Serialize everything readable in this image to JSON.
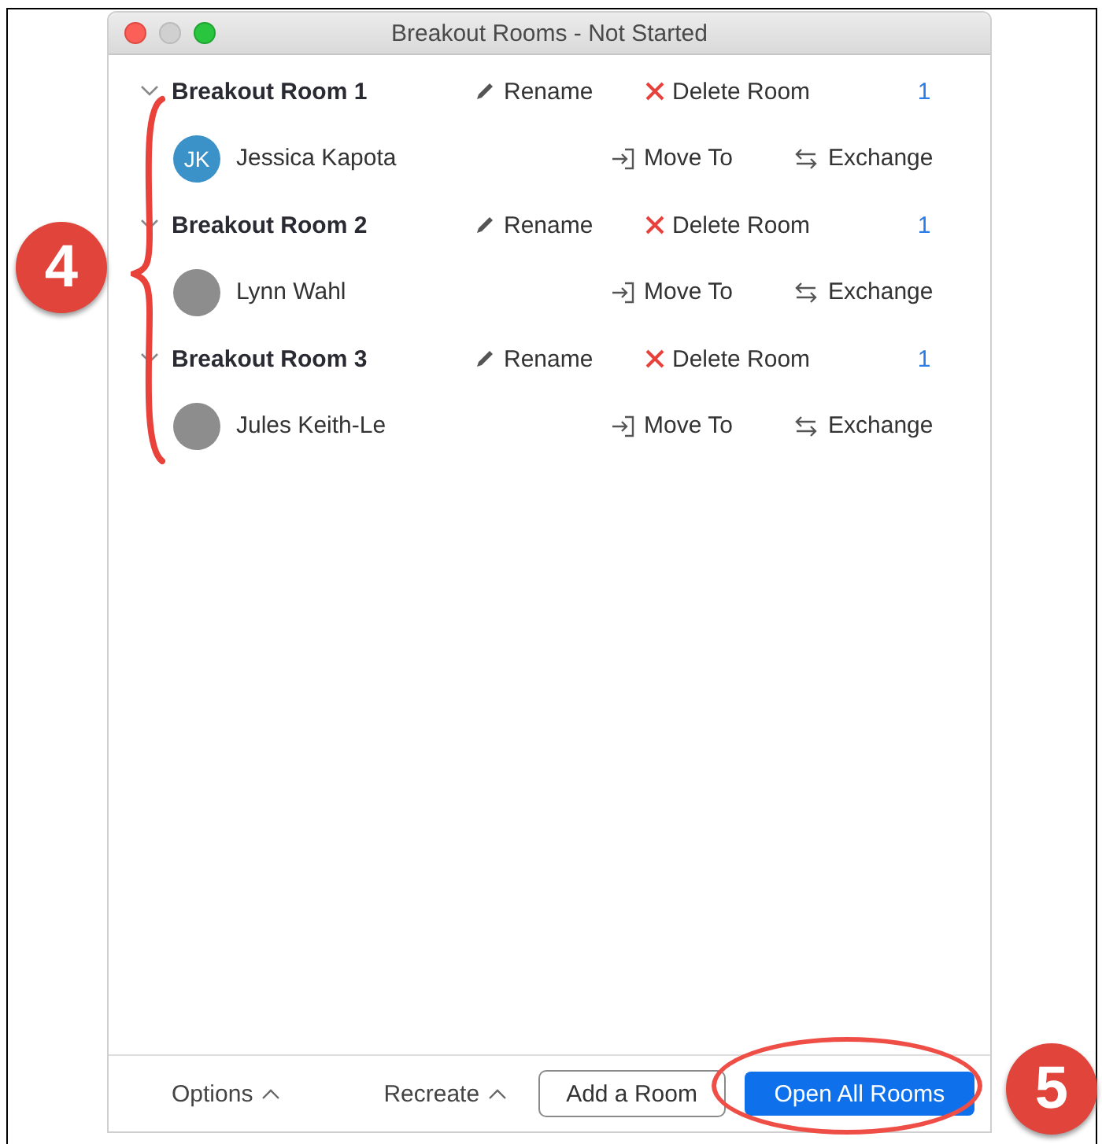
{
  "window": {
    "title": "Breakout Rooms - Not Started"
  },
  "rooms": [
    {
      "name": "Breakout Room 1",
      "expanded": true,
      "rename": "Rename",
      "delete": "Delete Room",
      "count": "1",
      "participants": [
        {
          "name": "Jessica Kapota",
          "kind": "initials",
          "initials": "JK",
          "move": "Move To",
          "exchange": "Exchange"
        }
      ]
    },
    {
      "name": "Breakout Room 2",
      "expanded": true,
      "rename": "Rename",
      "delete": "Delete Room",
      "count": "1",
      "participants": [
        {
          "name": "Lynn Wahl",
          "kind": "photo",
          "move": "Move To",
          "exchange": "Exchange"
        }
      ]
    },
    {
      "name": "Breakout Room 3",
      "expanded": true,
      "rename": "Rename",
      "delete": "Delete Room",
      "count": "1",
      "participants": [
        {
          "name": "Jules Keith-Le",
          "kind": "photo",
          "move": "Move To",
          "exchange": "Exchange"
        }
      ]
    }
  ],
  "footer": {
    "options": "Options",
    "recreate": "Recreate",
    "add_room": "Add a Room",
    "open_all": "Open All Rooms"
  },
  "callouts": [
    {
      "number": "4",
      "kind": "brace"
    },
    {
      "number": "5",
      "kind": "ellipse"
    }
  ]
}
